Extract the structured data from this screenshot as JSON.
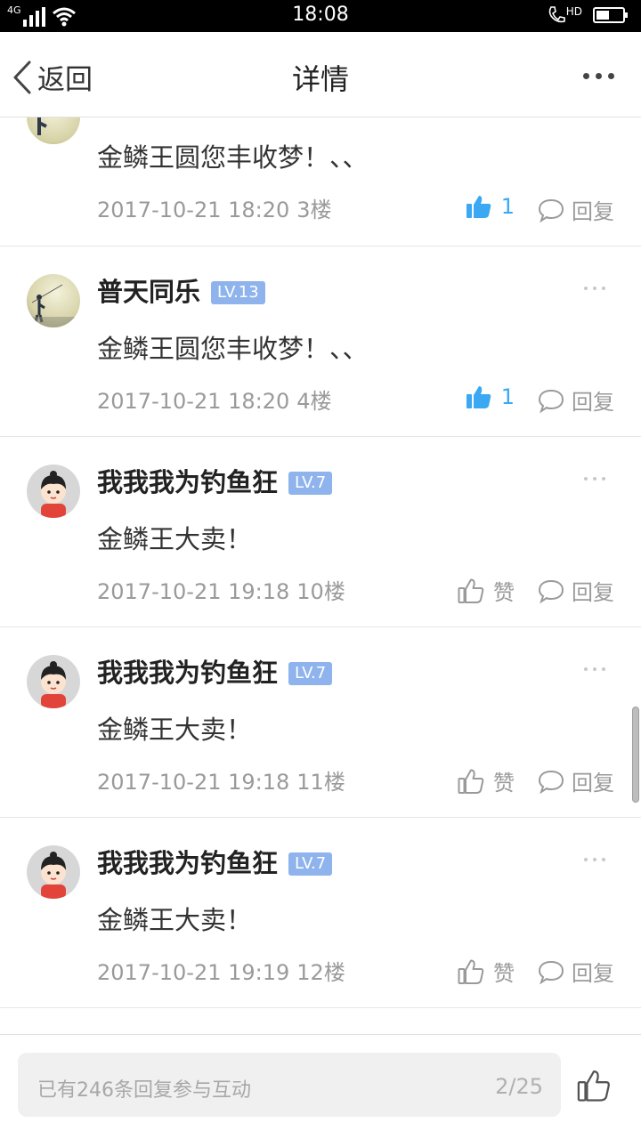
{
  "status_bar": {
    "time": "18:08",
    "network": "4G",
    "hd": "HD"
  },
  "header": {
    "back_label": "返回",
    "title": "详情"
  },
  "posts": [
    {
      "content": "金鳞王圆您丰收梦！、、",
      "date": "2017-10-21 18:20",
      "floor": "3楼",
      "likes": "1",
      "liked": true,
      "reply_label": "回复"
    },
    {
      "username": "普天同乐",
      "level": "LV.13",
      "content": "金鳞王圆您丰收梦！、、",
      "date": "2017-10-21 18:20",
      "floor": "4楼",
      "likes": "1",
      "liked": true,
      "reply_label": "回复"
    },
    {
      "username": "我我我为钓鱼狂",
      "level": "LV.7",
      "content": "金鳞王大卖！",
      "date": "2017-10-21 19:18",
      "floor": "10楼",
      "like_label": "赞",
      "liked": false,
      "reply_label": "回复"
    },
    {
      "username": "我我我为钓鱼狂",
      "level": "LV.7",
      "content": "金鳞王大卖！",
      "date": "2017-10-21 19:18",
      "floor": "11楼",
      "like_label": "赞",
      "liked": false,
      "reply_label": "回复"
    },
    {
      "username": "我我我为钓鱼狂",
      "level": "LV.7",
      "content": "金鳞王大卖！",
      "date": "2017-10-21 19:19",
      "floor": "12楼",
      "like_label": "赞",
      "liked": false,
      "reply_label": "回复"
    }
  ],
  "bottom_bar": {
    "placeholder": "已有246条回复参与互动",
    "page_indicator": "2/25"
  },
  "colors": {
    "accent_blue": "#3aa8f2",
    "level_badge": "#8fb3ec",
    "muted_text": "#9a9a9a"
  },
  "icons": [
    "back-chevron-icon",
    "more-icon",
    "thumbs-up-icon",
    "comment-bubble-icon",
    "signal-icon",
    "wifi-icon",
    "phone-hd-icon",
    "battery-icon"
  ]
}
